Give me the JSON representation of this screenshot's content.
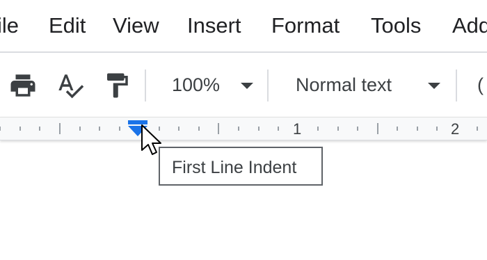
{
  "menubar": {
    "items": [
      "ile",
      "Edit",
      "View",
      "Insert",
      "Format",
      "Tools",
      "Add"
    ]
  },
  "toolbar": {
    "icons": [
      "print-icon",
      "spellcheck-icon",
      "paint-format-icon"
    ],
    "zoom_value": "100%",
    "style_value": "Normal text",
    "font_peek": "("
  },
  "ruler": {
    "labels": [
      "1",
      "2"
    ],
    "indent_marker_color": "#1a73e8"
  },
  "tooltip": {
    "text": "First Line Indent"
  }
}
